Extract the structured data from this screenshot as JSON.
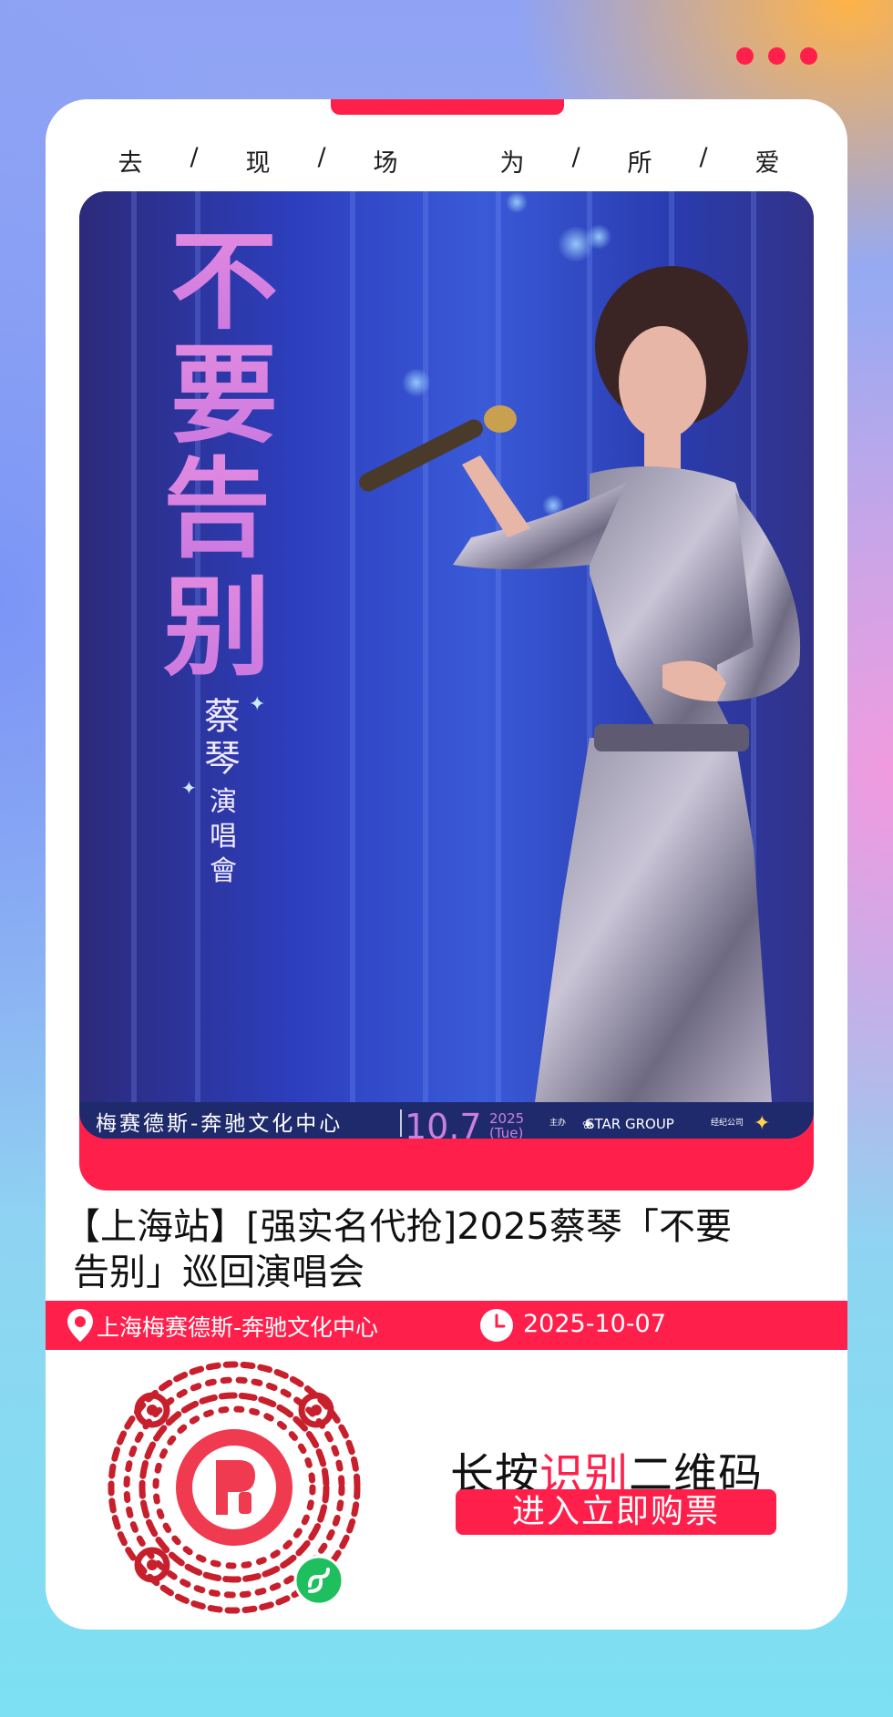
{
  "header": {
    "menu_icon": "more-dots-icon",
    "slogan": [
      "去",
      "/",
      "现",
      "/",
      "场",
      "为",
      "/",
      "所",
      "/",
      "爱"
    ]
  },
  "poster": {
    "title": "不要告别",
    "artist": "蔡琴演唱會",
    "artist_chars": [
      "蔡",
      "琴",
      "演",
      "唱",
      "會"
    ],
    "venue": "梅赛德斯-奔驰文化中心",
    "date_big": "10.7",
    "year": "2025",
    "weekday": "(Tue)",
    "organizer_label": "主办",
    "organizer": "STAR GROUP",
    "agency_label": "经纪公司"
  },
  "event": {
    "title_line1": "【上海站】[强实名代抢]2025蔡琴「不要",
    "title_line2": "告别」巡回演唱会",
    "venue": "上海梅赛德斯-奔驰文化中心",
    "venue_icon": "location-pin-icon",
    "date": "2025-10-07",
    "date_icon": "clock-icon"
  },
  "cta": {
    "title_prefix": "长按",
    "title_accent": "识别",
    "title_suffix": "二维码",
    "button_label": "进入立即购票"
  },
  "colors": {
    "accent": "#ff1f4b",
    "qr": "#c81f2d",
    "mini_program_badge": "#1fbf5f"
  }
}
